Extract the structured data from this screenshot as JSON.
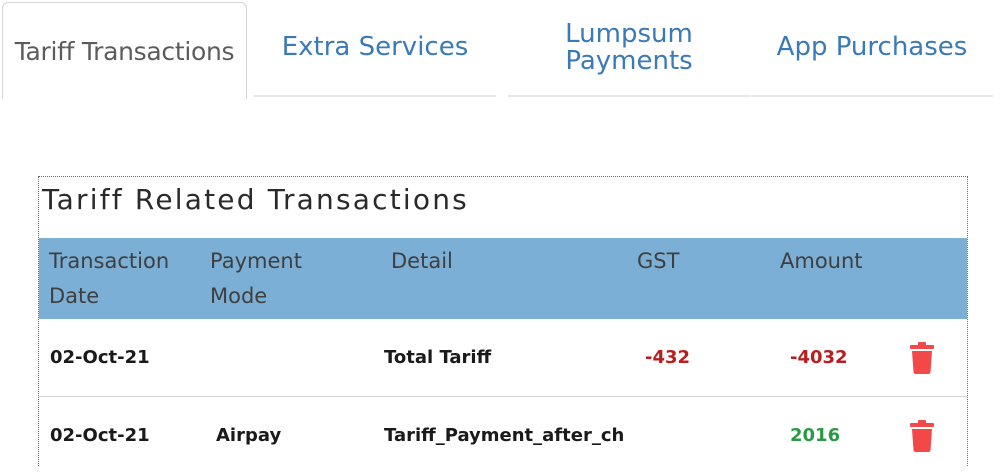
{
  "tabs": {
    "tariff": "Tariff Transactions",
    "extra": "Extra Services",
    "lumpsum": "Lumpsum Payments",
    "app": "App Purchases"
  },
  "panel": {
    "title": "Tariff Related Transactions"
  },
  "table": {
    "headers": {
      "date": "Transaction Date",
      "mode": "Payment Mode",
      "detail": "Detail",
      "gst": "GST",
      "amount": "Amount"
    },
    "rows": [
      {
        "date": "02-Oct-21",
        "mode": "",
        "detail": "Total Tariff",
        "gst": "-432",
        "amount": "-4032",
        "action_icon": "trash-icon"
      },
      {
        "date": "02-Oct-21",
        "mode": "Airpay",
        "detail": "Tariff_Payment_after_ch",
        "gst": "",
        "amount": "2016",
        "action_icon": "trash-icon"
      }
    ]
  },
  "colors": {
    "tab_active_text": "#5c5c5c",
    "tab_inactive_text": "#3a7ab6",
    "header_bg": "#7bafd6",
    "negative": "#b81e1e",
    "positive": "#2a9a47",
    "trash": "#f24848"
  }
}
